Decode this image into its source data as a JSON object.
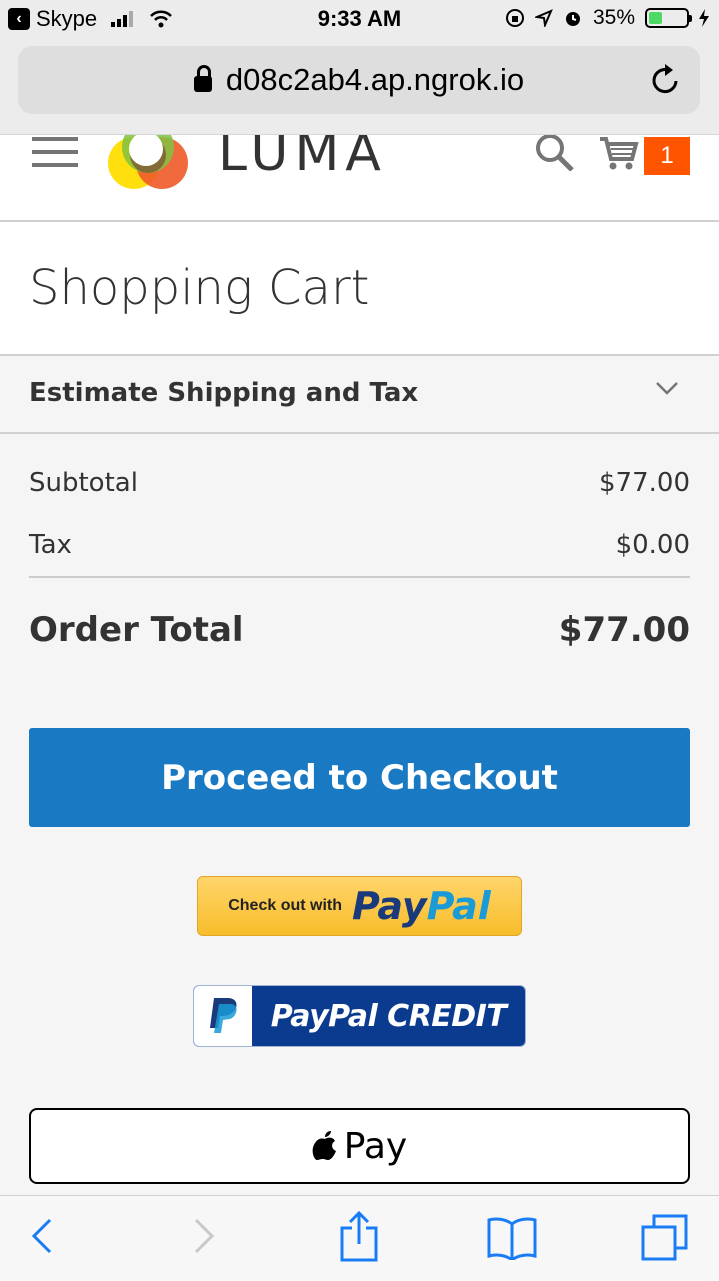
{
  "status_bar": {
    "back_app": "Skype",
    "time": "9:33 AM",
    "battery": "35%",
    "battery_level": 0.35
  },
  "browser": {
    "url": "d08c2ab4.ap.ngrok.io"
  },
  "header": {
    "brand": "LUMA",
    "cart_count": "1"
  },
  "page": {
    "title": "Shopping Cart",
    "estimate_label": "Estimate Shipping and Tax"
  },
  "summary": {
    "subtotal_label": "Subtotal",
    "subtotal_value": "$77.00",
    "tax_label": "Tax",
    "tax_value": "$0.00",
    "total_label": "Order Total",
    "total_value": "$77.00"
  },
  "actions": {
    "checkout_label": "Proceed to Checkout",
    "paypal_prefix": "Check out with",
    "paypal_pay": "Pay",
    "paypal_pal": "Pal",
    "paypal_credit": "PayPal CREDIT",
    "apple_pay": "Pay"
  },
  "colors": {
    "accent": "#1979c3",
    "cart_badge": "#ff5501"
  }
}
